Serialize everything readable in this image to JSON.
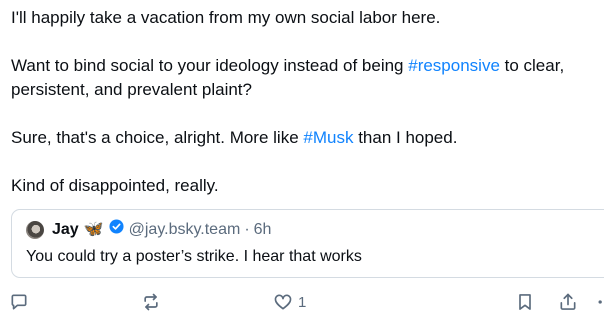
{
  "post": {
    "paragraphs": [
      [
        {
          "text": "I'll happily take a vacation from my own social labor here."
        }
      ],
      [
        {
          "text": "Want to bind social to your ideology instead of being "
        },
        {
          "text": "#responsive",
          "tag": true
        },
        {
          "text": " to clear, persistent, and prevalent plaint?"
        }
      ],
      [
        {
          "text": "Sure, that's a choice, alright. More like "
        },
        {
          "text": "#Musk",
          "tag": true
        },
        {
          "text": " than I hoped."
        }
      ],
      [
        {
          "text": "Kind of disappointed, really."
        }
      ]
    ]
  },
  "quote": {
    "author_name": "Jay",
    "author_emoji": "🦋",
    "handle": "@jay.bsky.team",
    "separator": "·",
    "time": "6h",
    "text": "You could try a poster’s strike. I hear that works"
  },
  "actions": {
    "reply_icon": "reply-bubble-icon",
    "repost_icon": "repost-icon",
    "like_icon": "heart-icon",
    "like_count": "1",
    "bookmark_icon": "bookmark-icon",
    "share_icon": "share-icon"
  },
  "colors": {
    "hashtag": "#1083fe",
    "muted": "#5b6b7d",
    "verified": "#1083fe",
    "border": "#d4dbe2"
  }
}
